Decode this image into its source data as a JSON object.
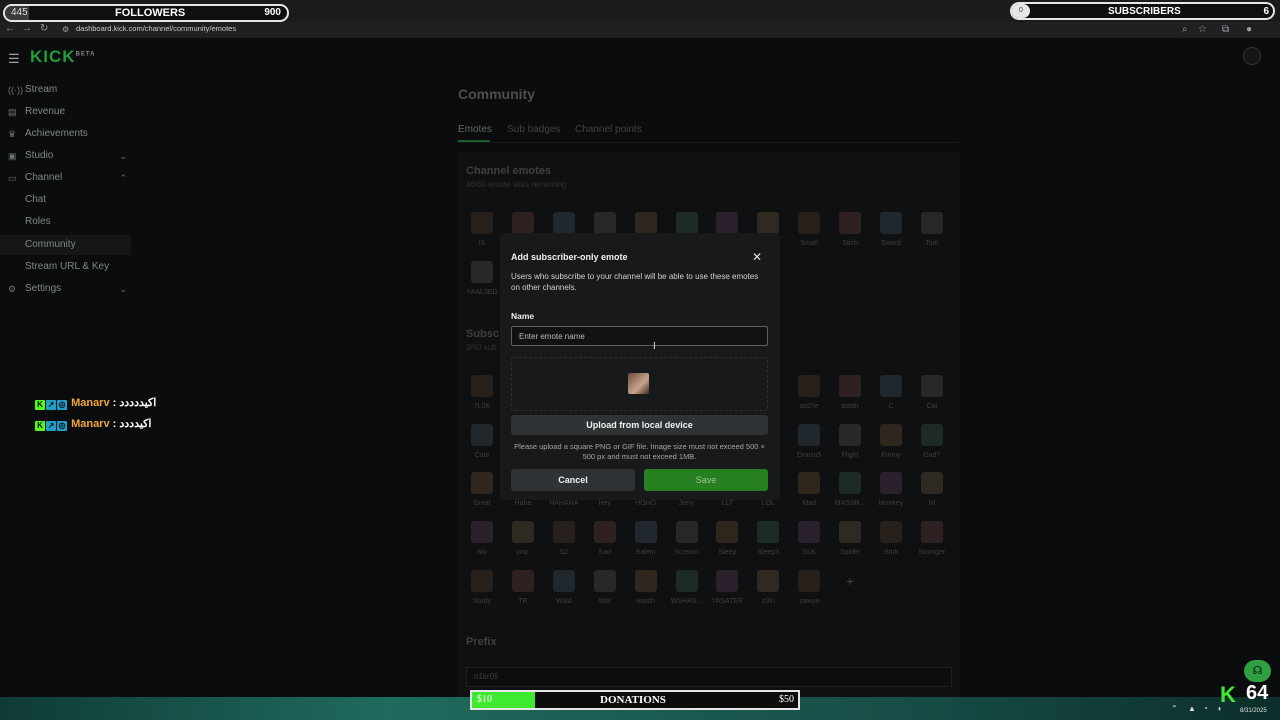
{
  "overlay": {
    "followers": {
      "left_value": "445",
      "title": "FOLLOWERS",
      "right_value": "900"
    },
    "subscribers": {
      "title": "SUBSCRIBERS",
      "right_value": "6"
    },
    "donations": {
      "left_value": "$10",
      "title": "DONATIONS",
      "right_value": "$50",
      "fill_fraction": 0.19
    },
    "kick_count": "64",
    "chat": [
      {
        "user": "Manarv",
        "sep": " : ",
        "message": "اكيددددد"
      },
      {
        "user": "Manarv",
        "sep": " : ",
        "message": "اكيدددد"
      }
    ]
  },
  "browser": {
    "url": "dashboard.kick.com/channel/community/emotes"
  },
  "brand": {
    "logo": "KICK",
    "logo_sup": "BETA",
    "accent": "#53fc18"
  },
  "sidebar": {
    "items": [
      {
        "label": "Stream",
        "icon": "broadcast-icon"
      },
      {
        "label": "Revenue",
        "icon": "revenue-icon"
      },
      {
        "label": "Achievements",
        "icon": "trophy-icon"
      },
      {
        "label": "Studio",
        "icon": "studio-icon",
        "expandable": true
      },
      {
        "label": "Channel",
        "icon": "channel-icon",
        "expandable": true,
        "expanded": true
      },
      {
        "label": "Chat"
      },
      {
        "label": "Roles"
      },
      {
        "label": "Community",
        "active": true
      },
      {
        "label": "Stream URL & Key"
      },
      {
        "label": "Settings",
        "icon": "gear-icon",
        "expandable": true
      }
    ]
  },
  "page": {
    "title": "Community",
    "tabs": [
      {
        "label": "Emotes",
        "active": true
      },
      {
        "label": "Sub badges"
      },
      {
        "label": "Channel points"
      }
    ],
    "channel_emotes": {
      "title": "Channel emotes",
      "subtitle": "46/60 emote slots remaining",
      "row1_labels": [
        "IS",
        "",
        "",
        "",
        "",
        "",
        "",
        "",
        "Small",
        "Stich",
        "Sword",
        "Tom"
      ],
      "row2_labels": [
        "YAAL3BD"
      ]
    },
    "subscriber_emotes": {
      "title": "Subsc",
      "subtitle": "3/60 sub",
      "rows": [
        [
          "7L0K",
          "",
          "",
          "",
          "",
          "",
          "",
          "",
          "ast7le",
          "astdn",
          "C",
          "Cat"
        ],
        [
          "Cute",
          "",
          "",
          "",
          "",
          "",
          "",
          "",
          "Dracin5",
          "Flight",
          "Funny",
          "Gad7"
        ],
        [
          "Great",
          "Haha",
          "HAHAHA",
          "Hey",
          "HOHO",
          "Jerry",
          "LLT",
          "LOL",
          "Mad",
          "MASSR...",
          "Monkey",
          "Nl"
        ],
        [
          "No",
          "pop",
          "S2",
          "Sad",
          "Salem",
          "Scream",
          "Sleep",
          "Sleep3",
          "SLK",
          "Spider",
          "Stnk",
          "Stronger"
        ],
        [
          "Study",
          "TR",
          "Wald",
          "Wat",
          "watch",
          "WSHAS...",
          "YASATER",
          "z3ln",
          "zawya",
          "+"
        ]
      ]
    },
    "prefix": {
      "title": "Prefix",
      "value": "n1kr05"
    }
  },
  "modal": {
    "title": "Add subscriber-only emote",
    "description": "Users who subscribe to your channel will be able to use these emotes on other channels.",
    "name_label": "Name",
    "name_placeholder": "Enter emote name",
    "name_value": "",
    "upload_label": "Upload from local device",
    "help_text": "Please upload a square PNG or GIF file. Image size must not exceed 500 × 500 px and must not exceed 1MB.",
    "cancel_label": "Cancel",
    "save_label": "Save",
    "close_icon": "close-icon"
  },
  "taskbar": {
    "date": "8/31/2025"
  }
}
